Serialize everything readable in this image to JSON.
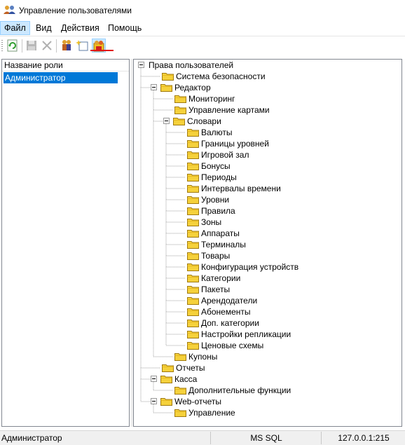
{
  "window": {
    "title": "Управление пользователями",
    "app_icon": "users-icon"
  },
  "menu": {
    "file": "Файл",
    "view": "Вид",
    "actions": "Действия",
    "help": "Помощь"
  },
  "toolbar": {
    "buttons": [
      {
        "name": "refresh-icon",
        "enabled": true
      },
      {
        "name": "save-icon",
        "enabled": false
      },
      {
        "name": "delete-icon",
        "enabled": false
      },
      {
        "name": "users-icon",
        "enabled": true
      },
      {
        "name": "new-item-icon",
        "enabled": true
      },
      {
        "name": "permissions-icon",
        "enabled": true,
        "pressed": true
      }
    ],
    "highlight_color": "#e01515"
  },
  "roles": {
    "header": "Название роли",
    "rows": [
      "Администратор"
    ],
    "selected_color": "#0078d7"
  },
  "tree": {
    "root": "Права пользователей",
    "security": "Система безопасности",
    "editor": "Редактор",
    "monitoring": "Мониторинг",
    "map_management": "Управление картами",
    "dictionaries": "Словари",
    "dict_items": [
      "Валюты",
      "Границы уровней",
      "Игровой зал",
      "Бонусы",
      "Периоды",
      "Интервалы времени",
      "Уровни",
      "Правила",
      "Зоны",
      "Аппараты",
      "Терминалы",
      "Товары",
      "Конфигурация устройств",
      "Категории",
      "Пакеты",
      "Арендодатели",
      "Абонементы",
      "Доп. категории",
      "Настройки репликации",
      "Ценовые схемы"
    ],
    "coupons": "Купоны",
    "reports": "Отчеты",
    "cashbox": "Касса",
    "extra_functions": "Дополнительные функции",
    "web_reports": "Web-отчеты",
    "management": "Управление",
    "folder_color": "#f5d13b"
  },
  "status": {
    "user": "Администратор",
    "db": "MS SQL",
    "host": "127.0.0.1:215"
  }
}
